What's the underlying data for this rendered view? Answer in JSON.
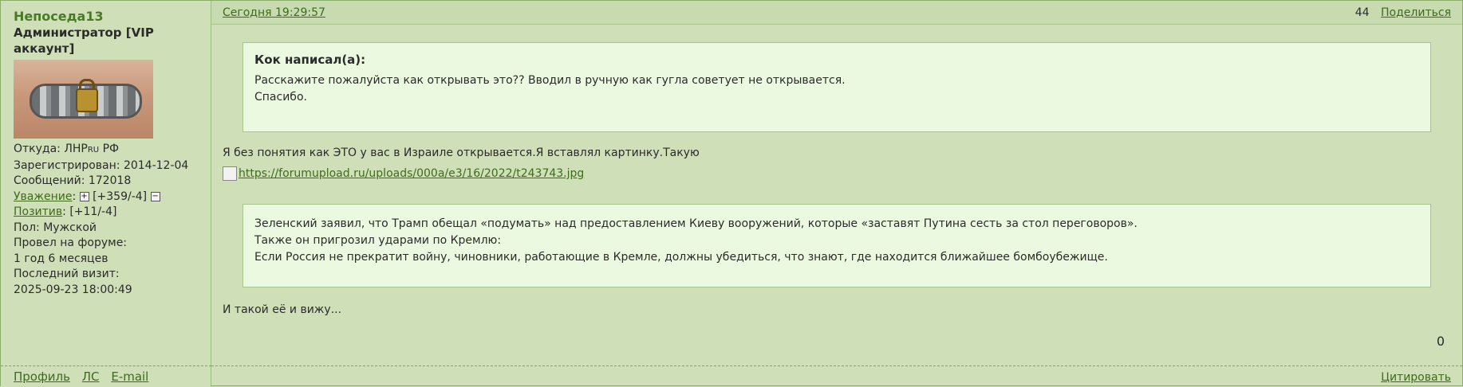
{
  "author": {
    "username": "Непоседа13",
    "title": "Администратор [VIP аккаунт]",
    "stats": {
      "from_label": "Откуда:",
      "from_value_pre": "ЛНР",
      "from_value_ru": "RU",
      "from_value_post": " РФ",
      "registered": "Зарегистрирован: 2014-12-04",
      "messages": "Сообщений: 172018",
      "respect_label": "Уважение",
      "respect_value": "[+359/-4]",
      "positive_label": "Позитив",
      "positive_value": "[+11/-4]",
      "gender": "Пол: Мужской",
      "forum_time_label": "Провел на форуме:",
      "forum_time_value": "1 год 6 месяцев",
      "last_visit_label": "Последний визит:",
      "last_visit_value": "2025-09-23 18:00:49"
    },
    "links": {
      "profile": "Профиль",
      "pm": "ЛС",
      "email": "E-mail"
    }
  },
  "post": {
    "date": "Сегодня 19:29:57",
    "number": "44",
    "share": "Поделиться",
    "quote1": {
      "title": "Кок написал(а):",
      "line1": "Расскажите пожалуйста как открывать это??  Вводил в ручную как гугла советует не открывается.",
      "line2": "Спасибо."
    },
    "text1": "Я без понятия как ЭТО у вас в Израиле открывается.Я вставлял картинку.Такую",
    "link": "https://forumupload.ru/uploads/000a/e3/16/2022/t243743.jpg",
    "quote2": {
      "line1": "Зеленский заявил, что Трамп обещал «подумать» над предоставлением Киеву вооружений, которые «заставят Путина сесть за стол переговоров».",
      "line2": "Также он пригрозил ударами по Кремлю:",
      "line3": "Если Россия не прекратит войну, чиновники, работающие в Кремле, должны убедиться, что знают, где находится ближайшее бомбоубежище."
    },
    "text2": "И такой её и вижу...",
    "rating": "0",
    "quote_button": "Цитировать"
  },
  "icons": {
    "plus": "plus-icon",
    "minus": "minus-icon",
    "broken_image": "broken-image-icon"
  }
}
